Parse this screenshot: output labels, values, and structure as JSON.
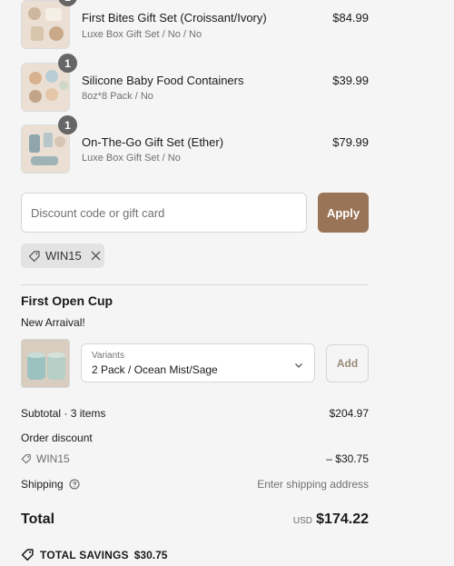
{
  "cart_items": [
    {
      "name": "First Bites Gift Set (Croissant/Ivory)",
      "variant": "Luxe Box Gift Set / No / No",
      "price": "$84.99",
      "quantity": "1"
    },
    {
      "name": "Silicone Baby Food Containers",
      "variant": "8oz*8 Pack / No",
      "price": "$39.99",
      "quantity": "1"
    },
    {
      "name": "On-The-Go Gift Set (Ether)",
      "variant": "Luxe Box Gift Set / No",
      "price": "$79.99",
      "quantity": "1"
    }
  ],
  "discount": {
    "placeholder": "Discount code or gift card",
    "apply_label": "Apply",
    "applied_code": "WIN15"
  },
  "upsell": {
    "title": "First Open Cup",
    "subtitle": "New Arraival!",
    "variant_label": "Variants",
    "variant_value": "2 Pack / Ocean Mist/Sage",
    "add_label": "Add"
  },
  "summary": {
    "subtotal_label": "Subtotal · 3 items",
    "subtotal_value": "$204.97",
    "order_discount_label": "Order discount",
    "discount_code": "WIN15",
    "discount_value": "– $30.75",
    "shipping_label": "Shipping",
    "shipping_value": "Enter shipping address",
    "total_label": "Total",
    "currency": "USD",
    "total_value": "$174.22",
    "savings_label": "TOTAL SAVINGS",
    "savings_value": "$30.75"
  },
  "colors": {
    "accent": "#9a7457",
    "badge": "#666666",
    "background": "#f5f5f5"
  },
  "icons": [
    "tag-icon",
    "close-icon",
    "chevron-down-icon",
    "help-icon"
  ]
}
